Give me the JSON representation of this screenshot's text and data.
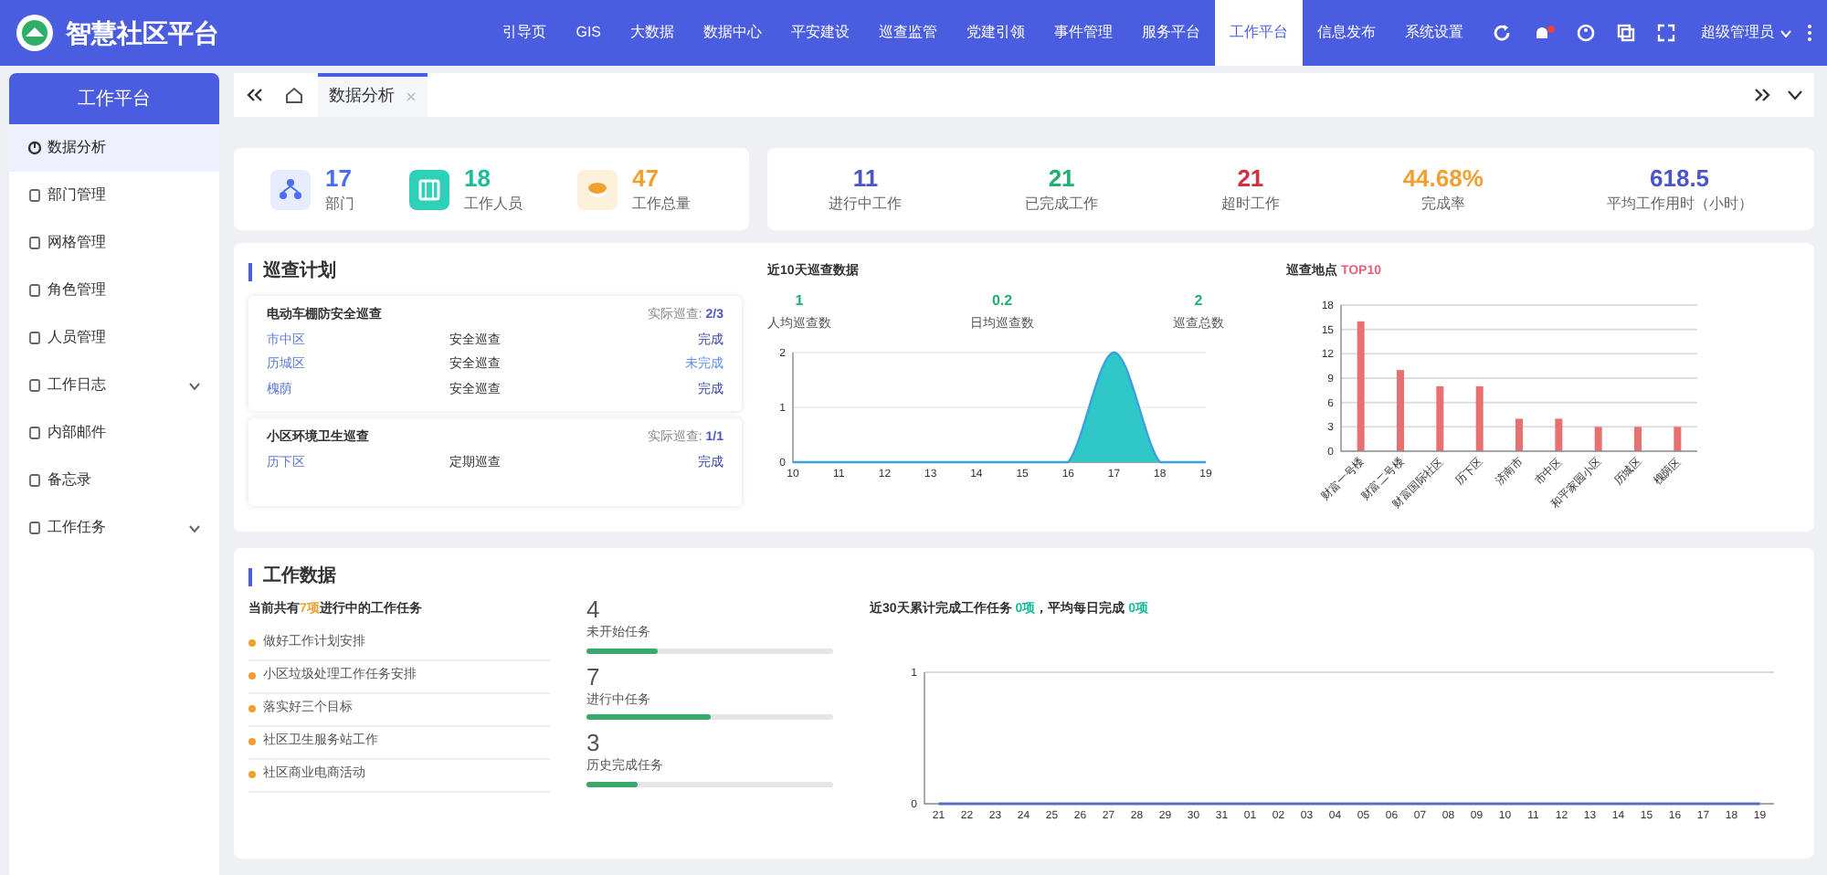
{
  "header": {
    "title": "智慧社区平台",
    "nav": [
      {
        "label": "引导页",
        "selected": false
      },
      {
        "label": "GIS",
        "selected": false
      },
      {
        "label": "大数据",
        "selected": false
      },
      {
        "label": "数据中心",
        "selected": false
      },
      {
        "label": "平安建设",
        "selected": false
      },
      {
        "label": "巡查监管",
        "selected": false
      },
      {
        "label": "党建引领",
        "selected": false
      },
      {
        "label": "事件管理",
        "selected": false
      },
      {
        "label": "服务平台",
        "selected": false
      },
      {
        "label": "工作平台",
        "selected": true
      },
      {
        "label": "信息发布",
        "selected": false
      },
      {
        "label": "系统设置",
        "selected": false
      }
    ],
    "user": "超级管理员"
  },
  "sidebar": {
    "title": "工作平台",
    "items": [
      {
        "label": "数据分析",
        "selected": true,
        "expandable": false
      },
      {
        "label": "部门管理",
        "selected": false,
        "expandable": false
      },
      {
        "label": "网格管理",
        "selected": false,
        "expandable": false
      },
      {
        "label": "角色管理",
        "selected": false,
        "expandable": false
      },
      {
        "label": "人员管理",
        "selected": false,
        "expandable": false
      },
      {
        "label": "工作日志",
        "selected": false,
        "expandable": true
      },
      {
        "label": "内部邮件",
        "selected": false,
        "expandable": false
      },
      {
        "label": "备忘录",
        "selected": false,
        "expandable": false
      },
      {
        "label": "工作任务",
        "selected": false,
        "expandable": true
      }
    ]
  },
  "tabs": [
    {
      "label": "数据分析",
      "selected": true
    }
  ],
  "summary_left": [
    {
      "value": "17",
      "label": "部门",
      "color": "#4a6cf7"
    },
    {
      "value": "18",
      "label": "工作人员",
      "color": "#1abc9c"
    },
    {
      "value": "47",
      "label": "工作总量",
      "color": "#f0a030"
    }
  ],
  "summary_right": [
    {
      "value": "11",
      "label": "进行中工作",
      "color": "#4a55c8"
    },
    {
      "value": "21",
      "label": "已完成工作",
      "color": "#20b070"
    },
    {
      "value": "21",
      "label": "超时工作",
      "color": "#d03040"
    },
    {
      "value": "44.68%",
      "label": "完成率",
      "color": "#f0a030"
    },
    {
      "value": "618.5",
      "label": "平均工作用时（小时）",
      "color": "#4a55c8"
    }
  ],
  "inspection": {
    "title": "巡查计划",
    "plans": [
      {
        "name": "电动车棚防安全巡查",
        "progress_label": "实际巡查:",
        "progress": "2/3",
        "rows": [
          {
            "area": "市中区",
            "type": "安全巡查",
            "status": "完成",
            "done": true
          },
          {
            "area": "历城区",
            "type": "安全巡查",
            "status": "未完成",
            "done": false
          },
          {
            "area": "槐荫",
            "type": "安全巡查",
            "status": "完成",
            "done": true
          }
        ]
      },
      {
        "name": "小区环境卫生巡查",
        "progress_label": "实际巡查:",
        "progress": "1/1",
        "rows": [
          {
            "area": "历下区",
            "type": "定期巡查",
            "status": "完成",
            "done": true
          }
        ]
      }
    ],
    "recent": {
      "title": "近10天巡查数据",
      "stats": [
        {
          "value": "1",
          "label": "人均巡查数"
        },
        {
          "value": "0.2",
          "label": "日均巡查数"
        },
        {
          "value": "2",
          "label": "巡查总数"
        }
      ],
      "chart_data": {
        "type": "area",
        "x": [
          10,
          11,
          12,
          13,
          14,
          15,
          16,
          17,
          18,
          19
        ],
        "series": [
          {
            "color": "#2ec8c8",
            "values": [
              0,
              0,
              0,
              0,
              0,
              0,
              0,
              2,
              0,
              0
            ]
          }
        ],
        "xlim": [
          10,
          19
        ],
        "ylim": [
          0,
          2
        ],
        "yticks": [
          0,
          1,
          2
        ],
        "xticks": [
          10,
          11,
          12,
          13,
          14,
          15,
          16,
          17,
          18,
          19
        ],
        "grid": true
      }
    },
    "top": {
      "title": "巡查地点",
      "highlight": "TOP10",
      "chart_data": {
        "type": "bar",
        "categories": [
          "财富一号楼",
          "财富二号楼",
          "财富国际社区",
          "历下区",
          "济南市",
          "市中区",
          "和平家园小区",
          "历城区",
          "槐荫区"
        ],
        "series": [
          {
            "color": "#e87070",
            "values": [
              16,
              10,
              8,
              8,
              4,
              4,
              3,
              3,
              3
            ]
          }
        ],
        "ylim": [
          0,
          18
        ],
        "yticks": [
          0,
          3,
          6,
          9,
          12,
          15,
          18
        ],
        "grid": true
      }
    }
  },
  "work": {
    "title": "工作数据",
    "summary": "当前共有**7项**进行中的工作任务",
    "tasks": [
      "做好工作计划安排",
      "小区垃圾处理工作任务安排",
      "落实好三个目标",
      "社区卫生服务站工作",
      "社区商业电商活动"
    ],
    "progress": [
      {
        "value": "4",
        "label": "未开始任务",
        "level": 0.29
      },
      {
        "value": "7",
        "label": "进行中任务",
        "level": 0.5
      },
      {
        "value": "3",
        "label": "历史完成任务",
        "level": 0.21
      }
    ],
    "recent": {
      "text": "近30天累计完成工作任务 **0项**，平均每日完成 **0项**",
      "chart_data": {
        "type": "line",
        "categories": [
          "21",
          "22",
          "23",
          "24",
          "25",
          "26",
          "27",
          "28",
          "29",
          "30",
          "31",
          "01",
          "02",
          "03",
          "04",
          "05",
          "06",
          "07",
          "08",
          "09",
          "10",
          "11",
          "12",
          "13",
          "14",
          "15",
          "16",
          "17",
          "18",
          "19"
        ],
        "series": [
          {
            "color": "#5470c6",
            "values": [
              0,
              0,
              0,
              0,
              0,
              0,
              0,
              0,
              0,
              0,
              0,
              0,
              0,
              0,
              0,
              0,
              0,
              0,
              0,
              0,
              0,
              0,
              0,
              0,
              0,
              0,
              0,
              0,
              0,
              0
            ]
          }
        ],
        "ylim": [
          0,
          1
        ],
        "yticks": [
          0,
          1
        ]
      }
    }
  }
}
